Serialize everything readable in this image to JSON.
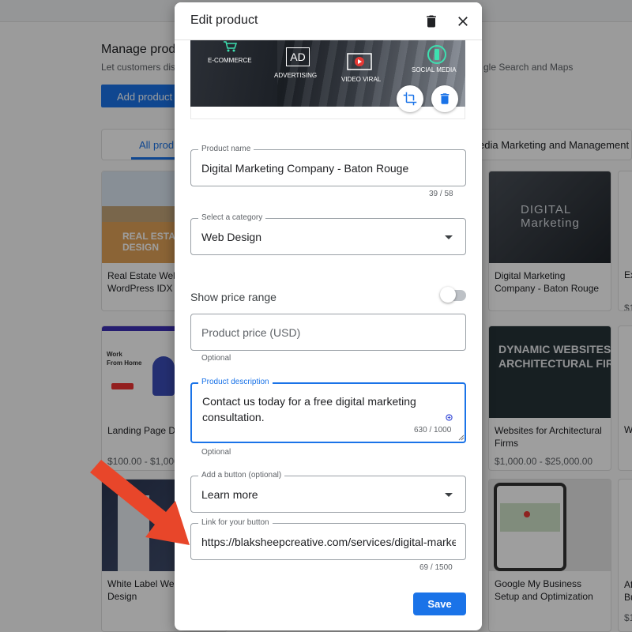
{
  "background": {
    "page_title": "Manage produ",
    "subtitle_left": "Let customers dis",
    "subtitle_right": "gle Search and Maps",
    "add_button": "Add product",
    "tab_active": "All prod",
    "tab_right": "edia Marketing and Management",
    "cards": [
      {
        "name": "Real Estate Web\nWordPress IDX I",
        "price": "",
        "image_text": "REAL ESTATE WEB\nDESIGN"
      },
      {
        "name": "Landing Page De",
        "price": "$100.00 - $1,000",
        "image_text": "Work\nFrom Home"
      },
      {
        "name": "White Label Web\nDesign",
        "price": "",
        "image_text": ""
      },
      {
        "name": "Digital Marketing\nCompany - Baton Rouge",
        "price": "",
        "image_text": "DIGITAL\nMarketing"
      },
      {
        "name": "Websites for Architectural\nFirms",
        "price": "$1,000.00 - $25,000.00",
        "image_text": "DYNAMIC WEBSITES FOR\nARCHITECTURAL FIRMS"
      },
      {
        "name": "Google My Business\nSetup and Optimization",
        "price": "",
        "image_text": ""
      }
    ],
    "edge_text": [
      "Ex",
      "$1",
      "W",
      "Af",
      "Bu",
      "$1"
    ]
  },
  "modal": {
    "title": "Edit product",
    "hero_labels": [
      "E-COMMERCE",
      "ADVERTISING",
      "VIDEO VIRAL",
      "SOCIAL MEDIA"
    ],
    "hero_ad_mark": "AD",
    "product_name": {
      "label": "Product name",
      "value": "Digital Marketing Company - Baton Rouge",
      "counter": "39 / 58"
    },
    "category": {
      "label": "Select a category",
      "value": "Web Design"
    },
    "price_range": {
      "label": "Show price range",
      "enabled": false
    },
    "price": {
      "placeholder": "Product price (USD)",
      "helper": "Optional"
    },
    "description": {
      "label": "Product description",
      "value": "Contact us today for a free digital marketing\nconsultation.",
      "counter": "630 / 1000",
      "helper": "Optional"
    },
    "button_select": {
      "label": "Add a button (optional)",
      "value": "Learn more"
    },
    "link": {
      "label": "Link for your button",
      "value": "https://blaksheepcreative.com/services/digital-marke",
      "counter": "69 / 1500"
    },
    "save_label": "Save"
  },
  "icons": [
    "trash-icon",
    "close-icon",
    "crop-icon",
    "trash-icon",
    "caret-down-icon",
    "resize-icon"
  ],
  "colors": {
    "accent": "#1a73e8",
    "arrow": "#e8462a",
    "overlay": "rgba(0,0,0,0.38)"
  }
}
